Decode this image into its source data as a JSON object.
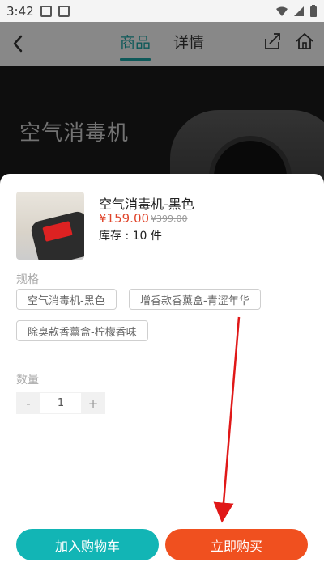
{
  "status_bar": {
    "time": "3:42",
    "left_icons": [
      "image-icon",
      "a-icon"
    ],
    "right_icons": [
      "wifi-icon",
      "signal-icon",
      "battery-icon"
    ]
  },
  "header": {
    "tabs": [
      {
        "label": "商品",
        "active": true
      },
      {
        "label": "详情",
        "active": false
      }
    ],
    "icons": [
      "back-icon",
      "share-icon",
      "home-icon"
    ]
  },
  "hero": {
    "title": "空气消毒机"
  },
  "product": {
    "name": "空气消毒机-黑色",
    "price": "¥159.00",
    "original_price": "¥399.00",
    "stock": "库存 : 10 件"
  },
  "spec": {
    "label": "规格",
    "options": [
      "空气消毒机-黑色",
      "增香款香薰盒-青涩年华",
      "除臭款香薰盒-柠檬香味"
    ]
  },
  "quantity": {
    "label": "数量",
    "minus": "-",
    "value": "1",
    "plus": "+"
  },
  "actions": {
    "add_to_cart": "加入购物车",
    "buy_now": "立即购买"
  },
  "colors": {
    "accent_teal": "#12b5b5",
    "accent_orange": "#f0501f",
    "price_red": "#e0452b",
    "arrow_red": "#e01818"
  }
}
